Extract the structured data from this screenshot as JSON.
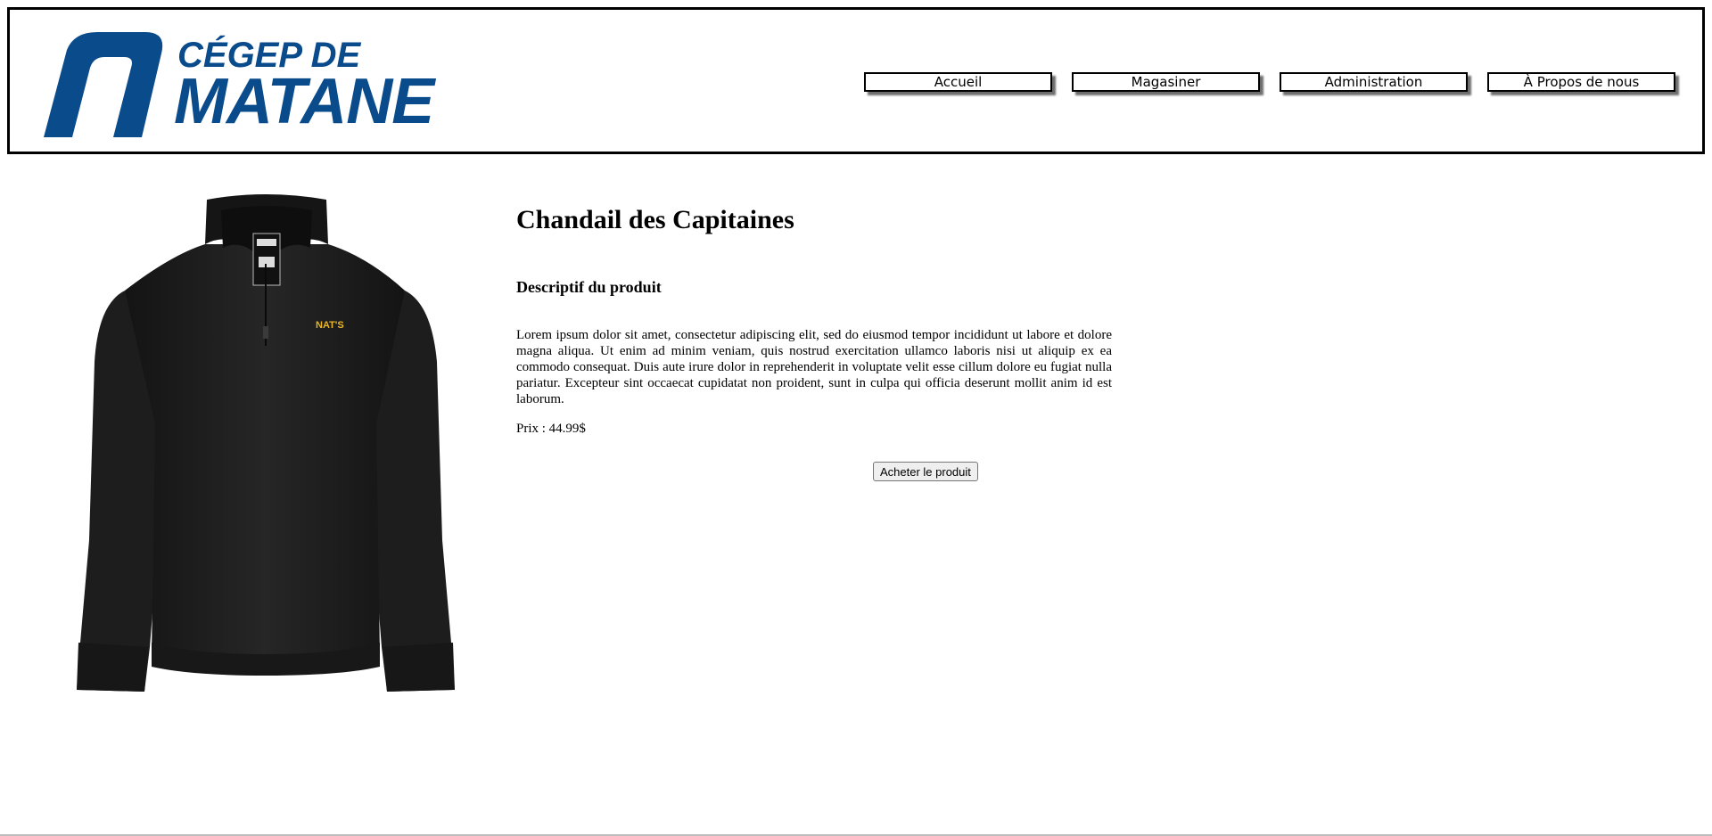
{
  "brand": {
    "line1": "CÉGEP DE",
    "line2": "MATANE",
    "color": "#0a4b8c"
  },
  "nav": {
    "items": [
      {
        "label": "Accueil"
      },
      {
        "label": "Magasiner"
      },
      {
        "label": "Administration"
      },
      {
        "label": "À Propos de nous"
      }
    ]
  },
  "product": {
    "title": "Chandail des Capitaines",
    "description_heading": "Descriptif du produit",
    "description": "Lorem ipsum dolor sit amet, consectetur adipiscing elit, sed do eiusmod tempor incididunt ut labore et dolore magna aliqua. Ut enim ad minim veniam, quis nostrud exercitation ullamco laboris nisi ut aliquip ex ea commodo consequat. Duis aute irure dolor in reprehenderit in voluptate velit esse cillum dolore eu fugiat nulla pariatur. Excepteur sint occaecat cupidatat non proident, sunt in culpa qui officia deserunt mollit anim id est laborum.",
    "price": "Prix : 44.99$",
    "buy_label": "Acheter le produit",
    "image": {
      "icon": "black-quarter-zip-sweater",
      "chest_logo": "NAT'S",
      "shirt_color": "#1c1c1c",
      "logo_color": "#e8b623"
    }
  }
}
